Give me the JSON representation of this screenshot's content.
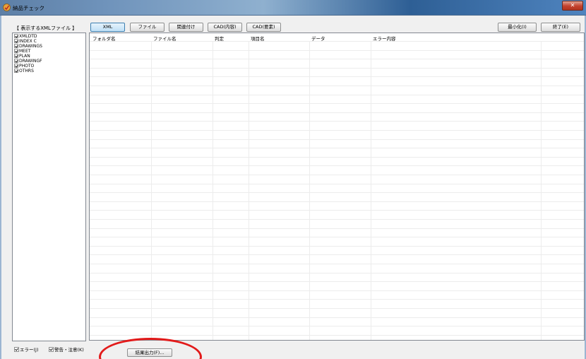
{
  "window": {
    "title": "納品チェック",
    "close_label": "✕"
  },
  "filter": {
    "header": "【 表示するXMLファイル 】",
    "items": [
      {
        "label": "XMLDTD",
        "checked": true
      },
      {
        "label": "INDEX C",
        "checked": true
      },
      {
        "label": "DRAWINGS",
        "checked": true
      },
      {
        "label": "MEET",
        "checked": true
      },
      {
        "label": "PLAN",
        "checked": true
      },
      {
        "label": "DRAWINGF",
        "checked": true
      },
      {
        "label": "PHOTO",
        "checked": true
      },
      {
        "label": "OTHRS",
        "checked": true
      }
    ]
  },
  "toolbar": {
    "tabs": [
      {
        "label": "XML",
        "selected": true
      },
      {
        "label": "ファイル"
      },
      {
        "label": "関連付け"
      },
      {
        "label": "CAD(内容)"
      },
      {
        "label": "CAD(要素)"
      }
    ],
    "minimize_label": "最小化(I)",
    "exit_label": "終了(E)"
  },
  "grid": {
    "columns": [
      "フォルダ名",
      "ファイル名",
      "判定",
      "項目名",
      "データ",
      "エラー内容"
    ],
    "rows": []
  },
  "footer": {
    "error_label": "エラー(J)",
    "error_checked": true,
    "warning_label": "警告・注意(K)",
    "warning_checked": true,
    "export_label": "結果出力(F)..."
  },
  "colors": {
    "annotation": "#e21a1a",
    "selected_tab": "#bfe0f6"
  }
}
